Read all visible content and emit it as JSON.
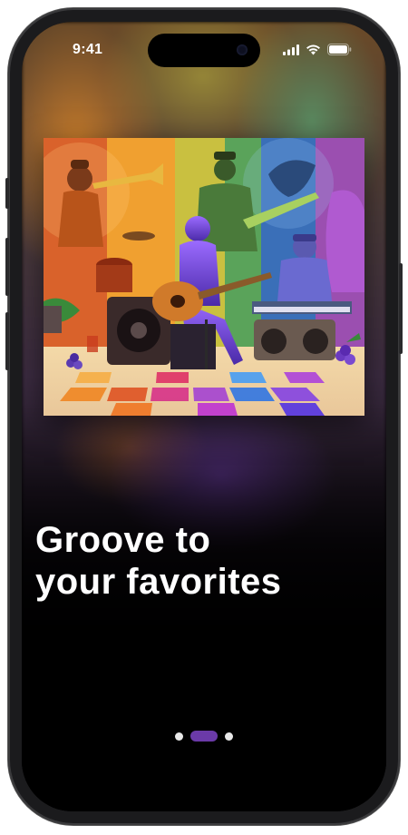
{
  "status_bar": {
    "time": "9:41"
  },
  "onboarding": {
    "headline_line1": "Groove to",
    "headline_line2": "your favorites",
    "pager": {
      "page_count": 3,
      "active_index": 1,
      "active_color": "#6b3aa8"
    }
  },
  "icons": {
    "signal": "cellular-signal-icon",
    "wifi": "wifi-icon",
    "battery": "battery-icon"
  }
}
